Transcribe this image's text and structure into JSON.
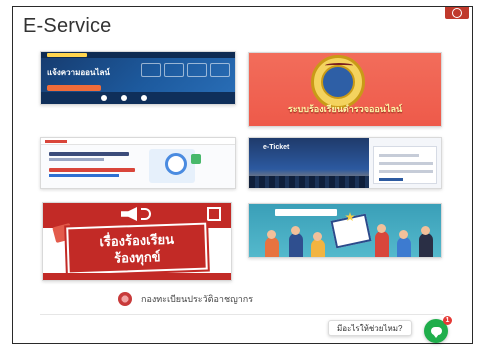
{
  "page": {
    "title": "E-Service"
  },
  "cards": [
    {
      "name": "online-complaint-card",
      "headline": "แจ้งความออนไลน์",
      "subline": ""
    },
    {
      "name": "complaint-system-card",
      "caption": "ระบบร้องเรียนตำรวจออนไลน์"
    },
    {
      "name": "form-card"
    },
    {
      "name": "e-ticket-card",
      "label": "e-Ticket"
    },
    {
      "name": "complaint-petition-card",
      "line1": "เรื่องร้องเรียน",
      "line2": "ร้องทุกข์"
    },
    {
      "name": "crowd-card"
    }
  ],
  "footer": {
    "org_name": "กองทะเบียนประวัติอาชญากร"
  },
  "chat": {
    "label": "มีอะไรให้ช่วยไหม?",
    "badge_count": "1"
  },
  "colors": {
    "chat_green": "#1fae4b",
    "badge_red": "#e53935",
    "card2_red": "#ee5a4a",
    "card5_red": "#c22a26"
  },
  "icons": [
    "chat-bubble-icon",
    "crest-icon",
    "megaphone-icon",
    "magnifier-icon"
  ]
}
